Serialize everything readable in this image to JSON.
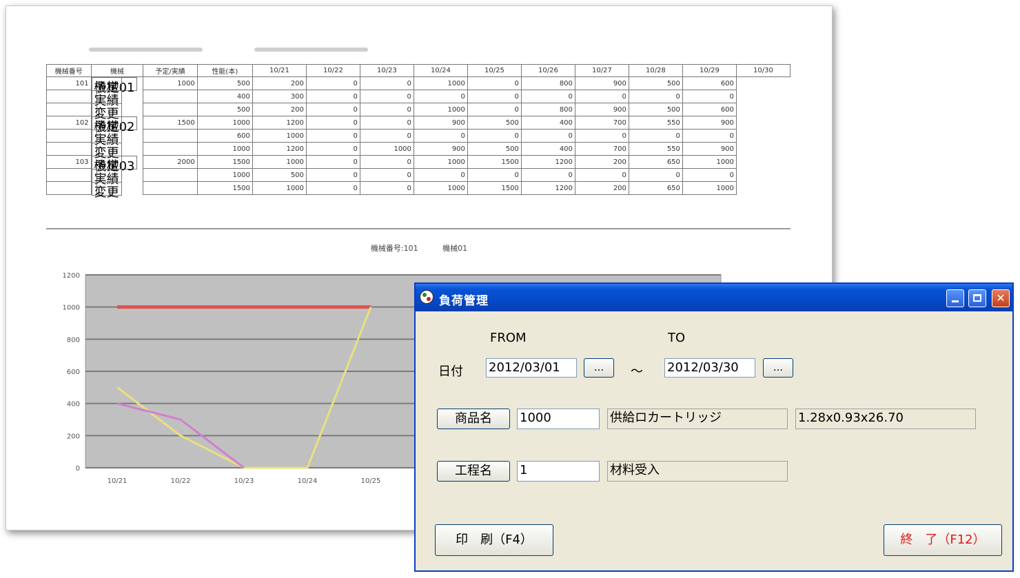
{
  "report": {
    "table_headers": [
      "機械番号",
      "機械",
      "予定/実績",
      "性能(本)",
      "10/21",
      "10/22",
      "10/23",
      "10/24",
      "10/25",
      "10/26",
      "10/27",
      "10/28",
      "10/29",
      "10/30"
    ],
    "groups": [
      {
        "no": "101",
        "machine": "機械01",
        "capacity": "1000",
        "rows": [
          {
            "kind": "予定",
            "values": [
              "500",
              "200",
              "0",
              "0",
              "1000",
              "0",
              "800",
              "900",
              "500",
              "600"
            ]
          },
          {
            "kind": "実績",
            "values": [
              "400",
              "300",
              "0",
              "0",
              "0",
              "0",
              "0",
              "0",
              "0",
              "0"
            ]
          },
          {
            "kind": "変更",
            "values": [
              "500",
              "200",
              "0",
              "0",
              "1000",
              "0",
              "800",
              "900",
              "500",
              "600"
            ]
          }
        ]
      },
      {
        "no": "102",
        "machine": "機械02",
        "capacity": "1500",
        "rows": [
          {
            "kind": "予定",
            "values": [
              "1000",
              "1200",
              "0",
              "0",
              "900",
              "500",
              "400",
              "700",
              "550",
              "900"
            ]
          },
          {
            "kind": "実績",
            "values": [
              "600",
              "1000",
              "0",
              "0",
              "0",
              "0",
              "0",
              "0",
              "0",
              "0"
            ]
          },
          {
            "kind": "変更",
            "values": [
              "1000",
              "1200",
              "0",
              "1000",
              "900",
              "500",
              "400",
              "700",
              "550",
              "900"
            ]
          }
        ]
      },
      {
        "no": "103",
        "machine": "機械03",
        "capacity": "2000",
        "rows": [
          {
            "kind": "予定",
            "values": [
              "1500",
              "1000",
              "0",
              "0",
              "1000",
              "1500",
              "1200",
              "200",
              "650",
              "1000"
            ]
          },
          {
            "kind": "実績",
            "values": [
              "1000",
              "500",
              "0",
              "0",
              "0",
              "0",
              "0",
              "0",
              "0",
              "0"
            ]
          },
          {
            "kind": "変更",
            "values": [
              "1500",
              "1000",
              "0",
              "0",
              "1000",
              "1500",
              "1200",
              "200",
              "650",
              "1000"
            ]
          }
        ]
      }
    ],
    "chart_caption": {
      "no_label": "機械番号:101",
      "machine_label": "機械01"
    }
  },
  "chart_data": {
    "type": "line",
    "title": "",
    "xlabel": "",
    "ylabel": "",
    "categories": [
      "10/21",
      "10/22",
      "10/23",
      "10/24",
      "10/25"
    ],
    "ylim": [
      0,
      1200
    ],
    "yticks": [
      0,
      200,
      400,
      600,
      800,
      1000,
      1200
    ],
    "grid": true,
    "series": [
      {
        "color": "#e05050",
        "values": [
          1000,
          1000,
          1000,
          1000,
          1000
        ]
      },
      {
        "color": "#e8e080",
        "values": [
          500,
          200,
          0,
          0,
          1000
        ]
      },
      {
        "color": "#d080d0",
        "values": [
          400,
          300,
          0,
          null,
          null
        ]
      }
    ]
  },
  "dialog": {
    "title": "負荷管理",
    "from_label": "FROM",
    "to_label": "TO",
    "date_label": "日付",
    "date_from": "2012/03/01",
    "date_to": "2012/03/30",
    "browse_label": "...",
    "range_sep": "～",
    "product_button": "商品名",
    "product_code": "1000",
    "product_name": "供給ロカートリッジ",
    "product_size": "1.28x0.93x26.70",
    "process_button": "工程名",
    "process_code": "1",
    "process_name": "材料受入",
    "print_button": "印　刷（F4）",
    "exit_button": "終　了（F12）",
    "colors": {
      "title_bar": "#0853d6",
      "exit_text": "#e01818",
      "window_bg": "#ece9d8"
    }
  }
}
